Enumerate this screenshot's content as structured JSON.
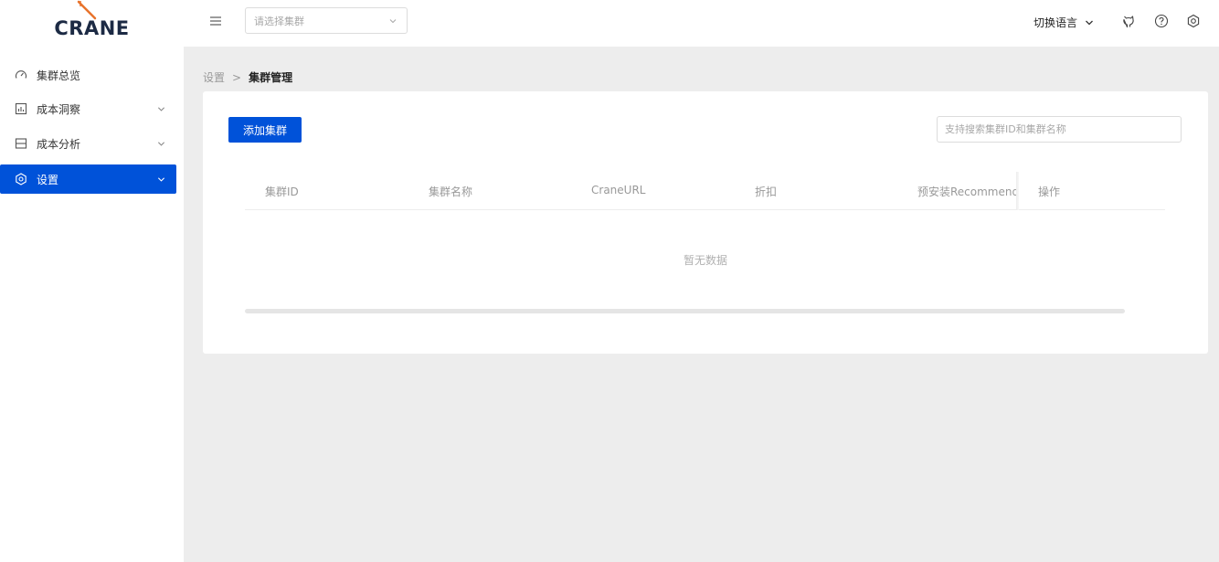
{
  "app": {
    "logo_text": "CRANE"
  },
  "header": {
    "cluster_select_placeholder": "请选择集群",
    "language_label": "切换语言",
    "icons": [
      "menu-icon",
      "github-icon",
      "help-icon",
      "settings-icon"
    ]
  },
  "sidebar": {
    "items": [
      {
        "label": "集群总览",
        "icon": "dashboard-icon",
        "expandable": false,
        "active": false
      },
      {
        "label": "成本洞察",
        "icon": "chart-icon",
        "expandable": true,
        "active": false
      },
      {
        "label": "成本分析",
        "icon": "analysis-icon",
        "expandable": true,
        "active": false
      },
      {
        "label": "设置",
        "icon": "settings-icon",
        "expandable": true,
        "active": true
      }
    ]
  },
  "breadcrumb": {
    "parent": "设置",
    "separator": ">",
    "current": "集群管理"
  },
  "main": {
    "add_button_label": "添加集群",
    "search_placeholder": "支持搜索集群ID和集群名称",
    "table": {
      "columns": [
        "集群ID",
        "集群名称",
        "CraneURL",
        "折扣",
        "预安装Recommend",
        "操作"
      ],
      "rows": [],
      "empty_text": "暂无数据"
    }
  },
  "colors": {
    "primary": "#0052d9",
    "background": "#ededed",
    "surface": "#ffffff"
  }
}
